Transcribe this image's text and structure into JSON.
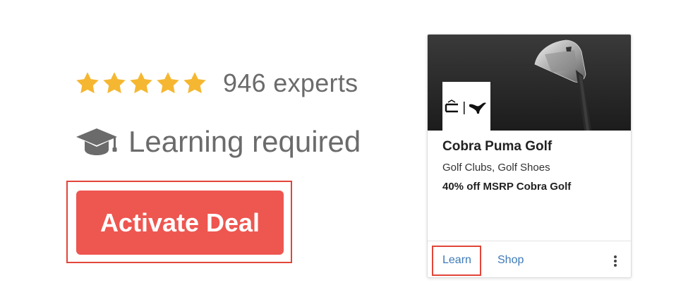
{
  "rating": {
    "stars": 5,
    "star_color": "#f5b731",
    "experts_label": "946 experts"
  },
  "learning": {
    "icon": "graduation-cap-icon",
    "label": "Learning required"
  },
  "deal_button": {
    "label": "Activate Deal",
    "color": "#ee5650"
  },
  "card": {
    "brand_name": "Cobra Puma Golf",
    "categories": "Golf Clubs, Golf Shoes",
    "offer": "40% off MSRP Cobra Golf",
    "learn_label": "Learn",
    "shop_label": "Shop",
    "menu_icon": "more-vertical-icon",
    "link_color": "#3d7ab8"
  },
  "highlight_color": "#e2453a"
}
